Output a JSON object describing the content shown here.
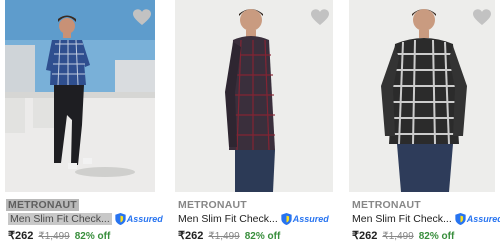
{
  "products": [
    {
      "brand": "METRONAUT",
      "title": "Men Slim Fit Check...",
      "assured_label": "Assured",
      "price": "₹262",
      "mrp": "₹1,499",
      "discount": "82% off"
    },
    {
      "brand": "METRONAUT",
      "title": "Men Slim Fit Check...",
      "assured_label": "Assured",
      "price": "₹262",
      "mrp": "₹1,499",
      "discount": "82% off"
    },
    {
      "brand": "METRONAUT",
      "title": "Men Slim Fit Check...",
      "assured_label": "Assured",
      "price": "₹262",
      "mrp": "₹1,499",
      "discount": "82% off"
    }
  ],
  "colors": {
    "accent": "#2874f0",
    "discount": "#388e3c",
    "muted": "#878787",
    "text": "#212121"
  },
  "icons": [
    "wishlist-heart-icon",
    "assured-shield-icon"
  ]
}
